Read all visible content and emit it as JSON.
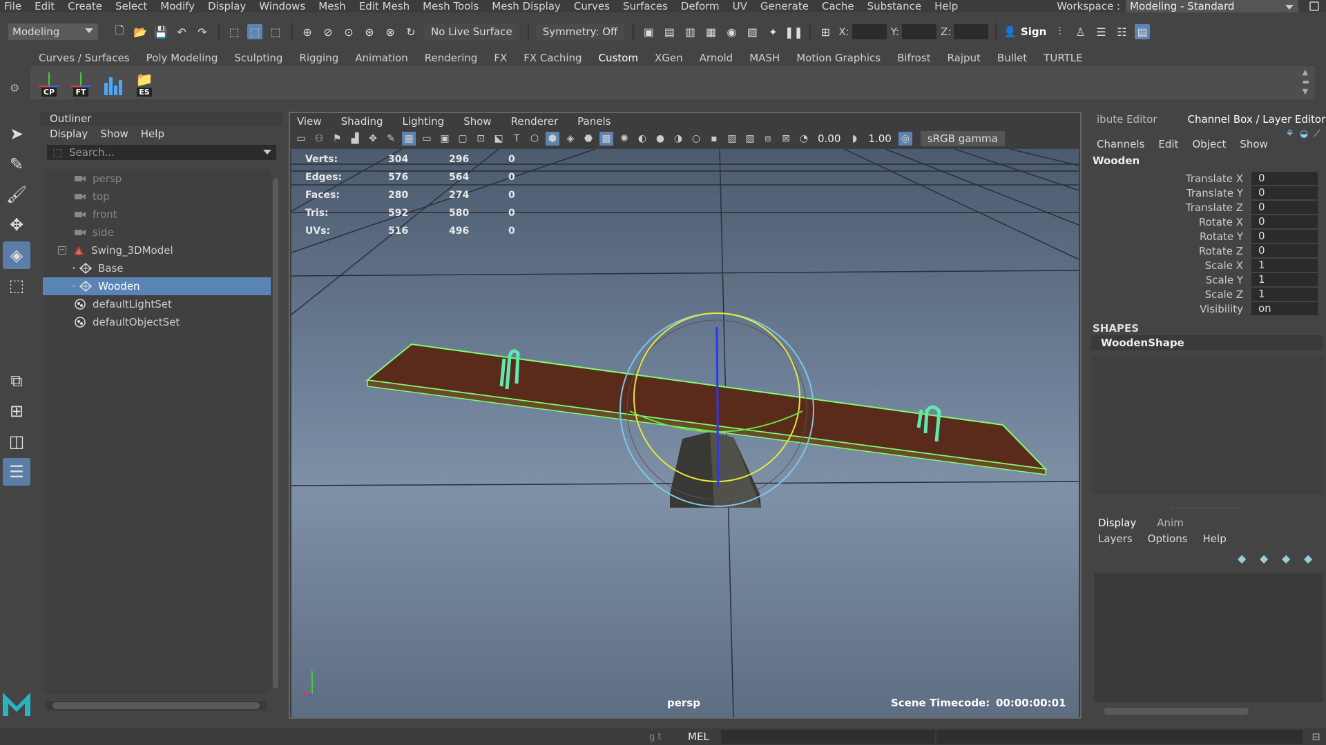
{
  "menubar": {
    "items": [
      "File",
      "Edit",
      "Create",
      "Select",
      "Modify",
      "Display",
      "Windows",
      "Mesh",
      "Edit Mesh",
      "Mesh Tools",
      "Mesh Display",
      "Curves",
      "Surfaces",
      "Deform",
      "UV",
      "Generate",
      "Cache",
      "Substance",
      "Help"
    ],
    "workspace_label": "Workspace :",
    "workspace_value": "Modeling - Standard"
  },
  "toolbar": {
    "mode": "Modeling",
    "live_surface": "No Live Surface",
    "symmetry": "Symmetry: Off",
    "x_label": "X:",
    "y_label": "Y:",
    "z_label": "Z:",
    "sign_in": "Sign"
  },
  "shelf": {
    "tabs": [
      "Curves / Surfaces",
      "Poly Modeling",
      "Sculpting",
      "Rigging",
      "Animation",
      "Rendering",
      "FX",
      "FX Caching",
      "Custom",
      "XGen",
      "Arnold",
      "MASH",
      "Motion Graphics",
      "Bifrost",
      "Rajput",
      "Bullet",
      "TURTLE"
    ],
    "active_tab": "Custom",
    "buttons": [
      "CP",
      "FT",
      "",
      "ES"
    ]
  },
  "outliner": {
    "title": "Outliner",
    "menu": [
      "Display",
      "Show",
      "Help"
    ],
    "search_placeholder": "Search...",
    "items": [
      {
        "label": "persp",
        "type": "camera",
        "indent": 0,
        "dim": true
      },
      {
        "label": "top",
        "type": "camera",
        "indent": 0,
        "dim": true
      },
      {
        "label": "front",
        "type": "camera",
        "indent": 0,
        "dim": true
      },
      {
        "label": "side",
        "type": "camera",
        "indent": 0,
        "dim": true
      },
      {
        "label": "Swing_3DModel",
        "type": "group",
        "indent": 0,
        "dim": false
      },
      {
        "label": "Base",
        "type": "mesh",
        "indent": 1,
        "dim": false
      },
      {
        "label": "Wooden",
        "type": "mesh",
        "indent": 1,
        "dim": false,
        "selected": true
      },
      {
        "label": "defaultLightSet",
        "type": "set",
        "indent": 0,
        "dim": false
      },
      {
        "label": "defaultObjectSet",
        "type": "set",
        "indent": 0,
        "dim": false
      }
    ]
  },
  "viewport": {
    "menu": [
      "View",
      "Shading",
      "Lighting",
      "Show",
      "Renderer",
      "Panels"
    ],
    "exposure": "0.00",
    "gamma": "1.00",
    "color_space": "sRGB gamma",
    "hud": [
      {
        "key": "Verts:",
        "a": "304",
        "b": "296",
        "c": "0"
      },
      {
        "key": "Edges:",
        "a": "576",
        "b": "564",
        "c": "0"
      },
      {
        "key": "Faces:",
        "a": "280",
        "b": "274",
        "c": "0"
      },
      {
        "key": "Tris:",
        "a": "592",
        "b": "580",
        "c": "0"
      },
      {
        "key": "UVs:",
        "a": "516",
        "b": "496",
        "c": "0"
      }
    ],
    "camera": "persp",
    "timecode_label": "Scene Timecode:",
    "timecode_value": "00:00:00:01"
  },
  "channel_box": {
    "tabs": [
      "ibute Editor",
      "Channel Box / Layer Editor"
    ],
    "menu": [
      "Channels",
      "Edit",
      "Object",
      "Show"
    ],
    "node": "Wooden",
    "attributes": [
      {
        "name": "Translate X",
        "value": "0"
      },
      {
        "name": "Translate Y",
        "value": "0"
      },
      {
        "name": "Translate Z",
        "value": "0"
      },
      {
        "name": "Rotate X",
        "value": "0"
      },
      {
        "name": "Rotate Y",
        "value": "0"
      },
      {
        "name": "Rotate Z",
        "value": "0"
      },
      {
        "name": "Scale X",
        "value": "1"
      },
      {
        "name": "Scale Y",
        "value": "1"
      },
      {
        "name": "Scale Z",
        "value": "1"
      },
      {
        "name": "Visibility",
        "value": "on"
      }
    ],
    "shapes_label": "SHAPES",
    "shape_name": "WoodenShape"
  },
  "layer_editor": {
    "tabs": [
      "Display",
      "Anim"
    ],
    "menu": [
      "Layers",
      "Options",
      "Help"
    ]
  },
  "statusbar": {
    "left_hint": "g t",
    "mel": "MEL"
  },
  "colors": {
    "selection": "#5a84b4",
    "wireframe_green": "#7dff6e",
    "wood": "#5a2a1a"
  }
}
